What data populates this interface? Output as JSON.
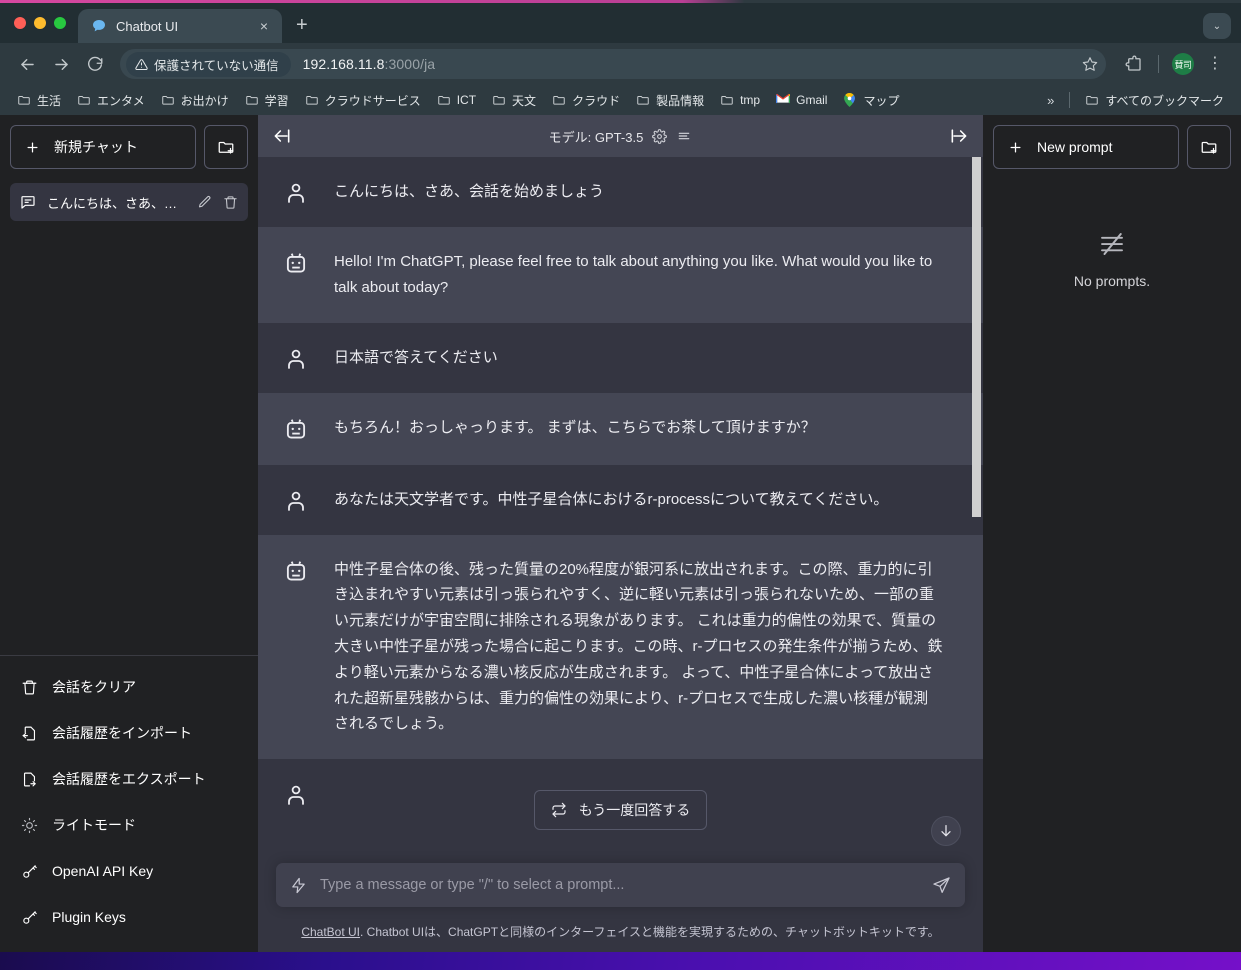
{
  "browser": {
    "tab": {
      "title": "Chatbot UI",
      "favicon": "speech-bubble-icon",
      "close_label": "×"
    },
    "new_tab_label": "+",
    "window_caret_label": "⌄",
    "nav": {
      "back": "←",
      "forward": "→",
      "reload": "↻"
    },
    "omnibox": {
      "security_label": "保護されていない通信",
      "security_icon": "warning-triangle-icon",
      "url_host": "192.168.11.8",
      "url_path": ":3000/ja",
      "bookmark_star": "☆"
    },
    "profile_initials": "賛司",
    "bookmarks": [
      {
        "label": "生活",
        "icon": "folder-icon"
      },
      {
        "label": "エンタメ",
        "icon": "folder-icon"
      },
      {
        "label": "お出かけ",
        "icon": "folder-icon"
      },
      {
        "label": "学習",
        "icon": "folder-icon"
      },
      {
        "label": "クラウドサービス",
        "icon": "folder-icon"
      },
      {
        "label": "ICT",
        "icon": "folder-icon"
      },
      {
        "label": "天文",
        "icon": "folder-icon"
      },
      {
        "label": "クラウド",
        "icon": "folder-icon"
      },
      {
        "label": "製品情報",
        "icon": "folder-icon"
      },
      {
        "label": "tmp",
        "icon": "folder-icon"
      },
      {
        "label": "Gmail",
        "icon": "gmail-icon"
      },
      {
        "label": "マップ",
        "icon": "maps-pin-icon"
      }
    ],
    "bookmarks_overflow": "»",
    "all_bookmarks_label": "すべてのブックマーク"
  },
  "left_sidebar": {
    "new_chat_label": "新規チャット",
    "new_chat_icon": "plus-icon",
    "new_folder_icon": "folder-plus-icon",
    "conversations": [
      {
        "label": "こんにちは、さあ、会...",
        "icon": "chat-bubble-icon"
      }
    ],
    "menu": [
      {
        "label": "会話をクリア",
        "icon": "trash-icon"
      },
      {
        "label": "会話履歴をインポート",
        "icon": "import-icon"
      },
      {
        "label": "会話履歴をエクスポート",
        "icon": "export-icon"
      },
      {
        "label": "ライトモード",
        "icon": "sun-icon"
      },
      {
        "label": "OpenAI API Key",
        "icon": "key-icon"
      },
      {
        "label": "Plugin Keys",
        "icon": "key-icon"
      }
    ]
  },
  "chat": {
    "header": {
      "model_label": "モデル: GPT-3.5",
      "settings_icon": "gear-icon",
      "list_icon": "lines-icon",
      "collapse_left_icon": "arrow-left-bar-icon",
      "collapse_right_icon": "arrow-right-bar-icon"
    },
    "messages": [
      {
        "role": "user",
        "icon": "person-icon",
        "text": "こんにちは、さあ、会話を始めましょう"
      },
      {
        "role": "bot",
        "icon": "robot-icon",
        "text": "Hello! I'm ChatGPT, please feel free to talk about anything you like. What would you like to talk about today?"
      },
      {
        "role": "user",
        "icon": "person-icon",
        "text": "日本語で答えてください"
      },
      {
        "role": "bot",
        "icon": "robot-icon",
        "text": "もちろん！おっしゃっります。 まずは、こちらでお茶して頂けますか？"
      },
      {
        "role": "user",
        "icon": "person-icon",
        "text": "あなたは天文学者です。中性子星合体におけるr-processについて教えてください。"
      },
      {
        "role": "bot",
        "icon": "robot-icon",
        "text": "中性子星合体の後、残った質量の20%程度が銀河系に放出されます。この際、重力的に引き込まれやすい元素は引っ張られやすく、逆に軽い元素は引っ張られないため、一部の重い元素だけが宇宙空間に排除される現象があります。 これは重力的偏性の効果で、質量の大きい中性子星が残った場合に起こります。この時、r-プロセスの発生条件が揃うため、鉄より軽い元素からなる濃い核反応が生成されます。 よって、中性子星合体によって放出された超新星残骸からは、重力的偏性の効果により、r-プロセスで生成した濃い核種が観測されるでしょう。"
      }
    ],
    "regenerate_label": "もう一度回答する",
    "regenerate_icon": "refresh-icon",
    "scroll_down_icon": "arrow-down-icon",
    "composer": {
      "placeholder": "Type a message or type \"/\" to select a prompt...",
      "prompt_icon": "lightning-icon",
      "send_icon": "send-icon"
    },
    "footnote_link": "ChatBot UI",
    "footnote_text": ". Chatbot UIは、ChatGPTと同様のインターフェイスと機能を実現するための、チャットボットキットです。"
  },
  "right_sidebar": {
    "new_prompt_label": "New prompt",
    "new_prompt_icon": "plus-icon",
    "new_folder_icon": "folder-plus-icon",
    "empty_icon": "no-prompts-icon",
    "empty_label": "No prompts."
  },
  "colors": {
    "chrome_bg": "#2e3a40",
    "tabstrip_bg": "#222e33",
    "tab_active": "#3b4a52",
    "sidebar_bg": "#202123",
    "chat_user_bg": "#343541",
    "chat_bot_bg": "#444654",
    "header_bg": "#444654",
    "accent_green": "#1e7d46",
    "desktop": "#4b0fb0"
  }
}
